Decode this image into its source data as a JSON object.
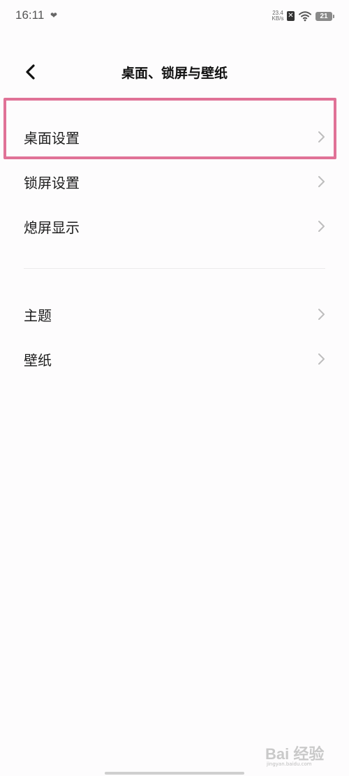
{
  "status_bar": {
    "time": "16:11",
    "net_speed_value": "23.4",
    "net_speed_unit": "KB/s",
    "sim_label": "✕",
    "battery_level": "21"
  },
  "header": {
    "title": "桌面、锁屏与壁纸"
  },
  "section1": {
    "items": [
      {
        "label": "桌面设置"
      },
      {
        "label": "锁屏设置"
      },
      {
        "label": "熄屏显示"
      }
    ]
  },
  "section2": {
    "items": [
      {
        "label": "主题"
      },
      {
        "label": "壁纸"
      }
    ]
  },
  "watermark": {
    "text": "Bai 经验",
    "url": "jingyan.baidu.com"
  },
  "colors": {
    "highlight": "#e07297",
    "background": "#fdfcfd"
  }
}
